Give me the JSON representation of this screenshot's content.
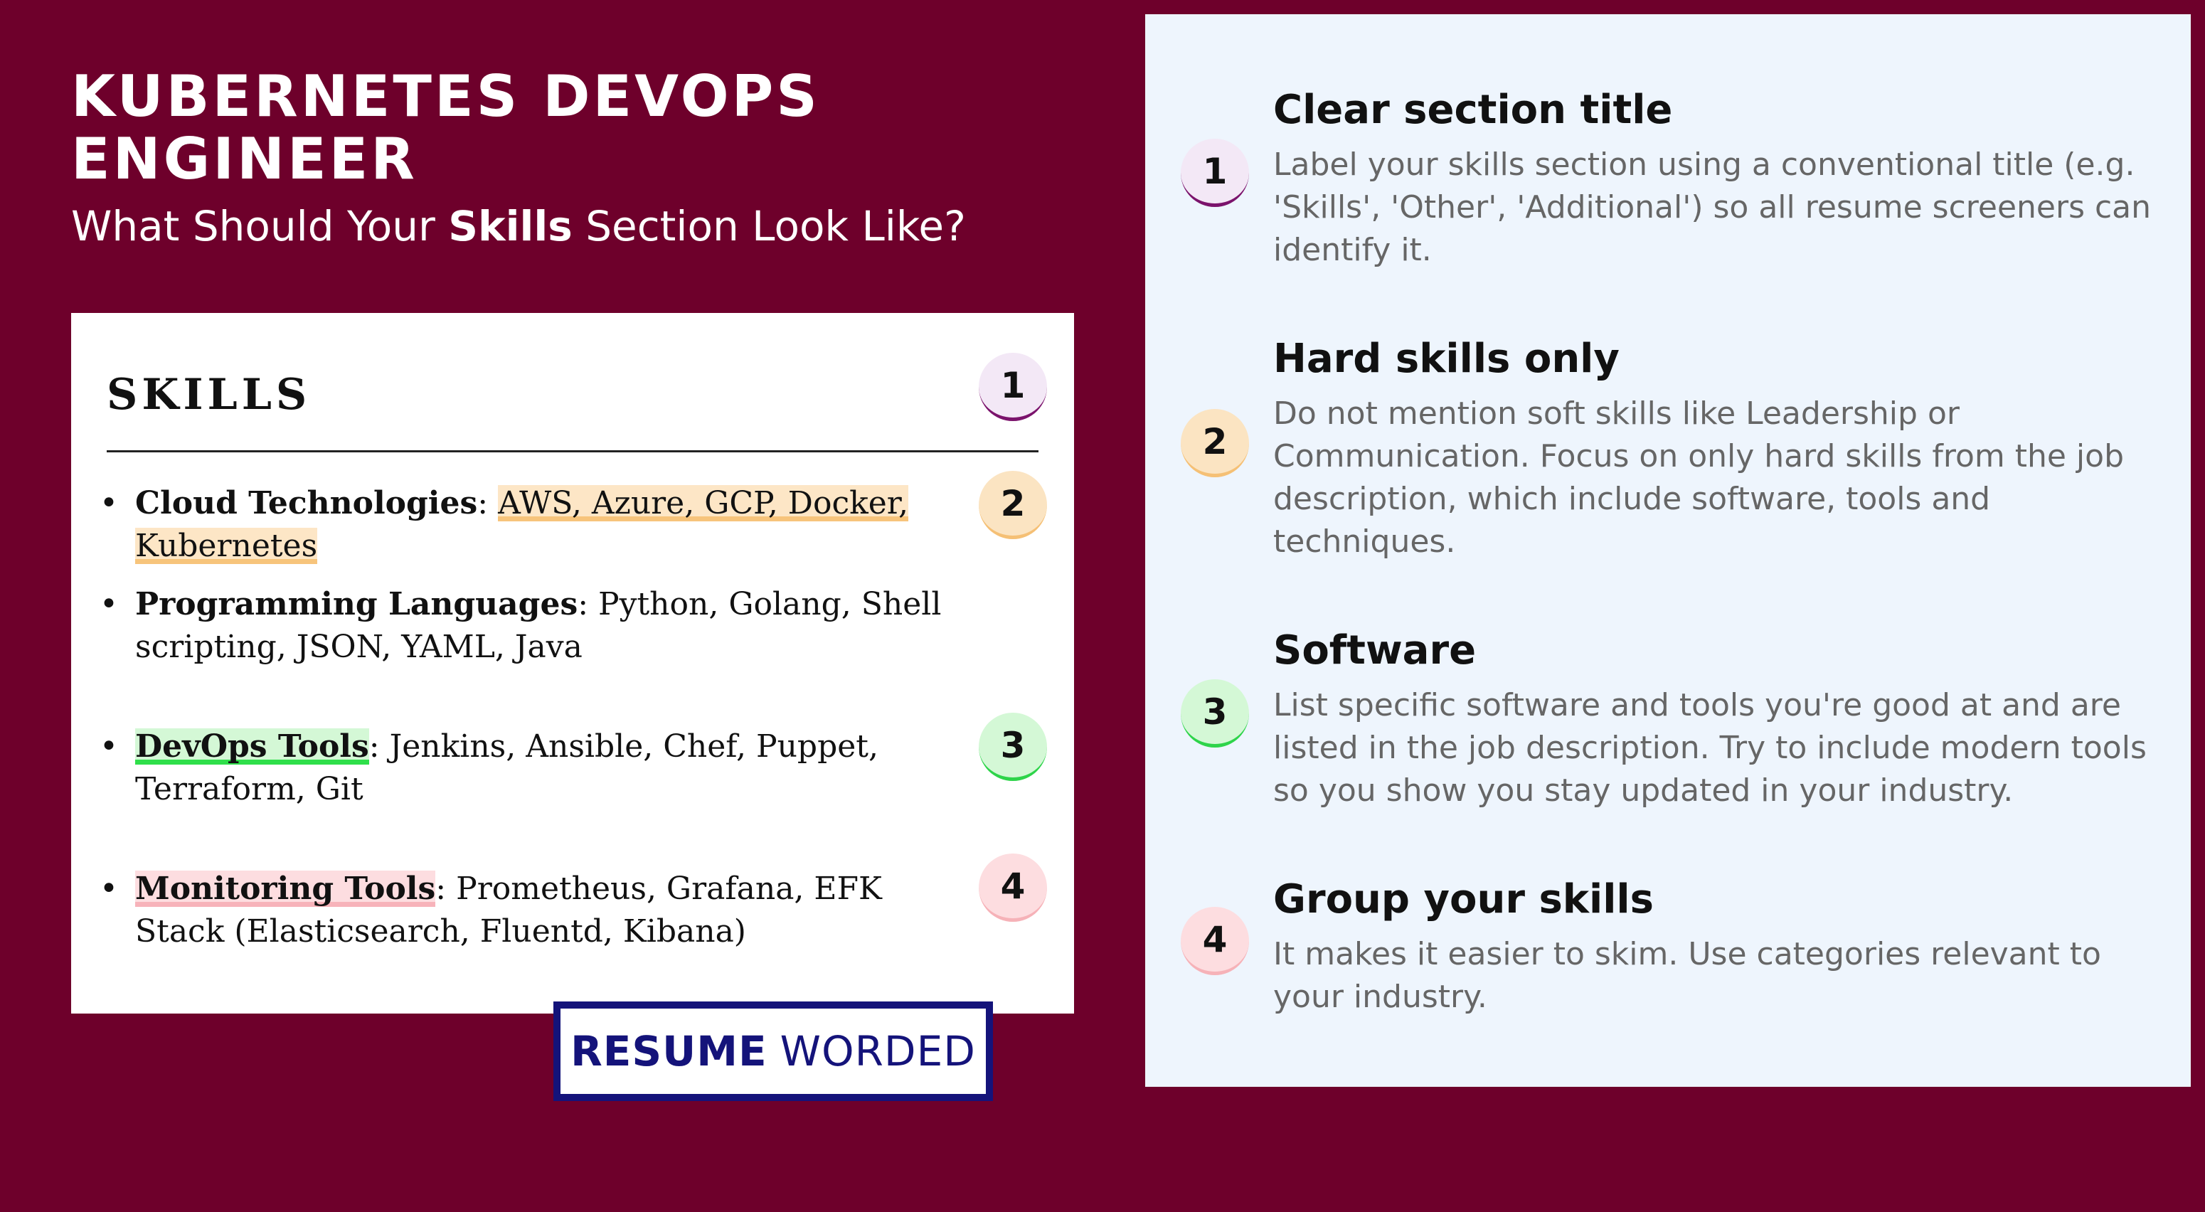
{
  "header": {
    "title": "KUBERNETES DEVOPS ENGINEER",
    "subtitle_before": "What Should Your ",
    "subtitle_bold": "Skills",
    "subtitle_after": " Section Look Like?"
  },
  "resume": {
    "heading": "SKILLS",
    "items": [
      {
        "label": "Cloud Technologies",
        "sep": ": ",
        "value": "AWS, Azure, GCP, Docker, Kubernetes"
      },
      {
        "label": "Programming Languages",
        "sep": ": ",
        "value": "Python, Golang, Shell scripting, JSON, YAML, Java"
      },
      {
        "label": "DevOps Tools",
        "sep": ": ",
        "value": "Jenkins, Ansible, Chef, Puppet, Terraform, Git"
      },
      {
        "label": "Monitoring Tools",
        "sep": ": ",
        "value": "Prometheus, Grafana, EFK Stack (Elasticsearch, Fluentd, Kibana)"
      }
    ],
    "bullet": "•",
    "badges": [
      "1",
      "2",
      "3",
      "4"
    ]
  },
  "logo": {
    "bold": "RESUME",
    "light": "WORDED",
    "color": "#14137a"
  },
  "tips": [
    {
      "number": "1",
      "title": "Clear section title",
      "body": "Label your skills section using a conventional title (e.g. 'Skills', 'Other', 'Additional') so all resume screeners can identify it."
    },
    {
      "number": "2",
      "title": "Hard skills only",
      "body": "Do not mention soft skills like Leadership or Communication. Focus on only hard skills from the job description, which include software, tools and techniques."
    },
    {
      "number": "3",
      "title": "Software",
      "body": "List specific software and tools you're good at and are listed in the job description. Try to include modern tools so you show you stay updated in your industry."
    },
    {
      "number": "4",
      "title": "Group your skills",
      "body": "It makes it easier to skim. Use categories relevant to your industry."
    }
  ],
  "colors": {
    "background": "#6e002b",
    "panel": "#eef5fd",
    "badge1": "#7b136c",
    "badge2": "#f5c075",
    "badge3": "#2ed44a",
    "badge4": "#f6b2b8"
  }
}
